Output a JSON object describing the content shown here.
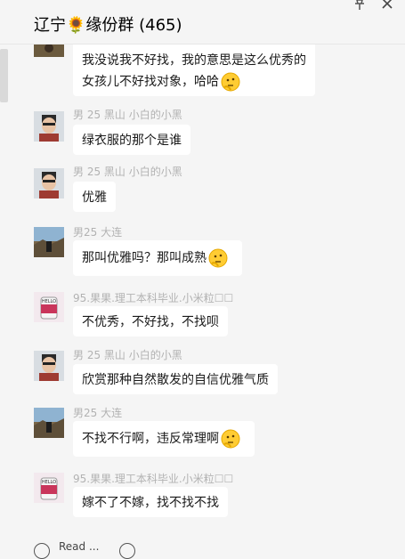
{
  "header": {
    "title": "辽宁🌻缘份群 (465)",
    "pin_icon": "pin-icon",
    "close_icon": "close-icon"
  },
  "messages": [
    {
      "sender": "",
      "lines": [
        "我没说我不好找，我的意思是这么优秀的",
        "女孩儿不好找对象，哈哈"
      ],
      "emoji": true,
      "avatar": "landscape"
    },
    {
      "sender": "男 25 黑山 小白的小黑",
      "lines": [
        "绿衣服的那个是谁"
      ],
      "emoji": false,
      "avatar": "man"
    },
    {
      "sender": "男 25 黑山 小白的小黑",
      "lines": [
        "优雅"
      ],
      "emoji": false,
      "avatar": "man"
    },
    {
      "sender": "男25 大连",
      "lines": [
        "那叫优雅吗？那叫成熟"
      ],
      "emoji": true,
      "avatar": "landscape"
    },
    {
      "sender": "95.果果.理工本科毕业.小米粒☐☐",
      "lines": [
        "不优秀，不好找，不找呗"
      ],
      "emoji": false,
      "avatar": "hello-cup"
    },
    {
      "sender": "男 25 黑山 小白的小黑",
      "lines": [
        "欣赏那种自然散发的自信优雅气质"
      ],
      "emoji": false,
      "avatar": "man"
    },
    {
      "sender": "男25 大连",
      "lines": [
        "不找不行啊，违反常理啊"
      ],
      "emoji": true,
      "avatar": "landscape"
    },
    {
      "sender": "95.果果.理工本科毕业.小米粒☐☐",
      "lines": [
        "嫁不了不嫁，找不找不找"
      ],
      "emoji": false,
      "avatar": "hello-cup"
    }
  ],
  "footer": {
    "text": "Read ..."
  }
}
